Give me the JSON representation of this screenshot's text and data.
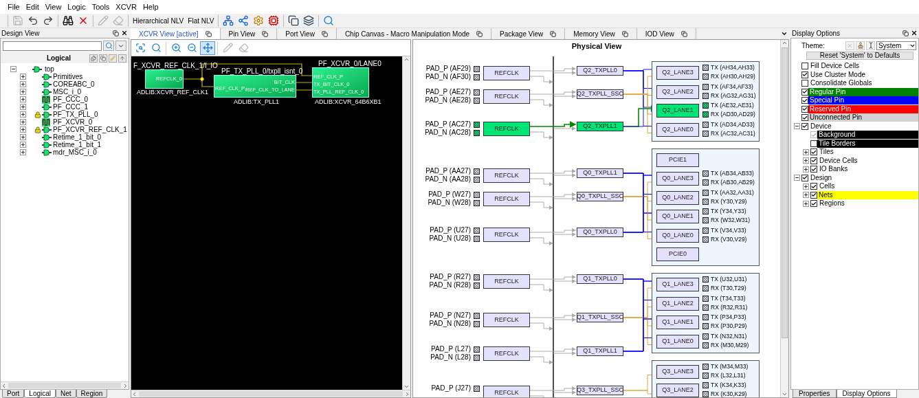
{
  "menu": [
    "File",
    "Edit",
    "View",
    "Logic",
    "Tools",
    "XCVR",
    "Help"
  ],
  "toolbar": [
    {
      "buttons": [
        {
          "kind": "save",
          "disabled": true
        },
        {
          "kind": "undo",
          "disabled": false
        },
        {
          "kind": "redo",
          "disabled": false
        }
      ]
    },
    {
      "buttons": [
        {
          "kind": "find",
          "disabled": false
        },
        {
          "kind": "delete",
          "disabled": false
        }
      ]
    },
    {
      "buttons": [
        {
          "kind": "edit",
          "disabled": true
        },
        {
          "kind": "erase",
          "disabled": true
        }
      ]
    },
    {
      "buttons": [
        {
          "kind": "text",
          "label": "Hierarchical NLV",
          "disabled": false
        },
        {
          "kind": "text",
          "label": "Flat NLV",
          "disabled": false
        }
      ]
    },
    {
      "buttons": [
        {
          "kind": "netin",
          "disabled": false
        },
        {
          "kind": "netout",
          "disabled": false
        },
        {
          "kind": "gear",
          "disabled": false
        },
        {
          "kind": "chip",
          "disabled": false
        }
      ]
    },
    {
      "buttons": [
        {
          "kind": "window",
          "disabled": false
        },
        {
          "kind": "windows",
          "disabled": false
        }
      ]
    },
    {
      "buttons": [
        {
          "kind": "zoom",
          "disabled": false
        }
      ]
    }
  ],
  "design_view": {
    "title": "Design View",
    "header": "Logical",
    "tree": {
      "label": "top",
      "kind": "gate",
      "locked": false,
      "expanded": true,
      "children": [
        {
          "label": "Primitives",
          "kind": "gate",
          "locked": false,
          "expanded": false
        },
        {
          "label": "COREABC_0",
          "kind": "gate",
          "locked": false,
          "expanded": false
        },
        {
          "label": "MSC_i_0",
          "kind": "gate",
          "locked": false,
          "expanded": false
        },
        {
          "label": "PF_CCC_0",
          "kind": "pulse",
          "locked": false,
          "expanded": false
        },
        {
          "label": "PF_CCC_1",
          "kind": "gate",
          "locked": false,
          "expanded": false
        },
        {
          "label": "PF_TX_PLL_0",
          "kind": "gate",
          "locked": true,
          "expanded": false
        },
        {
          "label": "PF_XCVR_0",
          "kind": "pulse",
          "locked": false,
          "expanded": false
        },
        {
          "label": "PF_XCVR_REF_CLK_1",
          "kind": "gate",
          "locked": true,
          "expanded": false
        },
        {
          "label": "Retime_1_bit_0",
          "kind": "gate",
          "locked": false,
          "expanded": false
        },
        {
          "label": "Retime_1_bit_1",
          "kind": "gate",
          "locked": false,
          "expanded": false
        },
        {
          "label": "mdr_MSC_i_0",
          "kind": "gate",
          "locked": false,
          "expanded": false
        }
      ]
    },
    "tabs": [
      {
        "label": "Port",
        "selected": false
      },
      {
        "label": "Logical",
        "selected": true
      },
      {
        "label": "Net",
        "selected": false
      },
      {
        "label": "Region",
        "selected": false
      }
    ]
  },
  "view_tabs": [
    {
      "label": "XCVR View [active]",
      "selected": true
    },
    {
      "label": "Pin View",
      "selected": false
    },
    {
      "label": "Port View",
      "selected": false
    },
    {
      "label": "Chip Canvas - Macro Manipulation Mode",
      "selected": false
    },
    {
      "label": "Package View",
      "selected": false
    },
    {
      "label": "Memory View",
      "selected": false
    },
    {
      "label": "IOD View",
      "selected": false
    }
  ],
  "xcvr_view": {
    "tools": [
      {
        "kind": "zoomwindow",
        "selected": false,
        "disabled": false
      },
      {
        "kind": "zoomcheck",
        "selected": false,
        "disabled": false
      },
      {
        "kind": "zoomin",
        "selected": false,
        "disabled": false
      },
      {
        "kind": "zoomout",
        "selected": false,
        "disabled": false
      },
      {
        "kind": "fit",
        "selected": true,
        "disabled": false
      },
      {
        "kind": "edit",
        "selected": false,
        "disabled": true
      },
      {
        "kind": "erase",
        "selected": false,
        "disabled": true
      }
    ],
    "nodes": [
      {
        "title": "F_XCVR_REF_CLK_1/I_IO",
        "type": "ADLIB:XCVR_REF_CLK1",
        "outputs": [
          "REFCLK_0"
        ]
      },
      {
        "title": "PF_TX_PLL_0/txpll_isnt_0",
        "type": "ADLIB:TX_PLL1",
        "inputs": [
          "REF_CLK_P"
        ],
        "outputs": [
          "BIT_CLK",
          "REF_CLK_TO_LANE"
        ]
      },
      {
        "title": "PF_XCVR_0/LANE0",
        "type": "ADLIB:XCVR_64B6XB1",
        "inputs": [
          "REF_CLK_P",
          "TX_BIT_CLK_0",
          "TX_PLL_REF_CLK_0"
        ]
      }
    ]
  },
  "physical_view": {
    "title": "Physical View",
    "quads": [
      {
        "refclks": [
          {
            "pad_p": "PAD_P (AF29)",
            "pad_n": "PAD_N (AF30)",
            "label": "REFCLK",
            "highlighted": false
          },
          {
            "pad_p": "PAD_P (AE27)",
            "pad_n": "PAD_N (AE28)",
            "label": "REFCLK",
            "highlighted": false
          },
          {
            "pad_p": "PAD_P (AC27)",
            "pad_n": "PAD_N (AC28)",
            "label": "REFCLK",
            "highlighted": true
          }
        ],
        "plls": [
          {
            "label": "Q2_TXPLL0",
            "kind": "pll",
            "highlighted": false
          },
          {
            "label": "Q2_TXPLL_SSC",
            "kind": "ssc",
            "highlighted": false
          },
          {
            "label": "Q2_TXPLL1",
            "kind": "pll",
            "highlighted": true
          }
        ],
        "items": [
          {
            "kind": "lane",
            "label": "Q2_LANE3",
            "highlighted": false,
            "tx": "TX (AH34,AH33)",
            "rx": "RX (AH30,AH29)"
          },
          {
            "kind": "lane",
            "label": "Q2_LANE2",
            "highlighted": false,
            "tx": "TX (AF34,AF33)",
            "rx": "RX (AG32,AG31)"
          },
          {
            "kind": "lane",
            "label": "Q2_LANE1",
            "highlighted": true,
            "tx": "TX (AE32,AE31)",
            "rx": "RX (AD30,AD29)"
          },
          {
            "kind": "lane",
            "label": "Q2_LANE0",
            "highlighted": false,
            "tx": "TX (AD34,AD33)",
            "rx": "RX (AC32,AC31)"
          }
        ]
      },
      {
        "refclks": [
          {
            "pad_p": "PAD_P (AA27)",
            "pad_n": "PAD_N (AA28)",
            "label": "REFCLK",
            "highlighted": false
          },
          {
            "pad_p": "PAD_P (W27)",
            "pad_n": "PAD_N (W28)",
            "label": "REFCLK",
            "highlighted": false
          },
          {
            "pad_p": "PAD_P (U27)",
            "pad_n": "PAD_N (U28)",
            "label": "REFCLK",
            "highlighted": false
          }
        ],
        "plls": [
          {
            "label": "Q0_TXPLL1",
            "kind": "pll",
            "highlighted": false
          },
          {
            "label": "Q0_TXPLL_SSC",
            "kind": "ssc",
            "highlighted": false
          },
          {
            "label": "Q0_TXPLL0",
            "kind": "pll",
            "highlighted": false
          }
        ],
        "items": [
          {
            "kind": "pcie",
            "label": "PCIE1",
            "highlighted": false
          },
          {
            "kind": "lane",
            "label": "Q0_LANE3",
            "highlighted": false,
            "tx": "TX (AB34,AB33)",
            "rx": "RX (AB30,AB29)"
          },
          {
            "kind": "lane",
            "label": "Q0_LANE2",
            "highlighted": false,
            "tx": "TX (AA32,AA31)",
            "rx": "RX (Y30,Y29)"
          },
          {
            "kind": "lane",
            "label": "Q0_LANE1",
            "highlighted": false,
            "tx": "TX (Y34,Y33)",
            "rx": "RX (W32,W31)"
          },
          {
            "kind": "lane",
            "label": "Q0_LANE0",
            "highlighted": false,
            "tx": "TX (V34,V33)",
            "rx": "RX (V30,V29)"
          },
          {
            "kind": "pcie",
            "label": "PCIE0",
            "highlighted": false
          }
        ]
      },
      {
        "refclks": [
          {
            "pad_p": "PAD_P (R27)",
            "pad_n": "PAD_N (R28)",
            "label": "REFCLK",
            "highlighted": false
          },
          {
            "pad_p": "PAD_P (N27)",
            "pad_n": "PAD_N (N28)",
            "label": "REFCLK",
            "highlighted": false
          },
          {
            "pad_p": "PAD_P (L27)",
            "pad_n": "PAD_N (L28)",
            "label": "REFCLK",
            "highlighted": false
          }
        ],
        "plls": [
          {
            "label": "Q1_TXPLL0",
            "kind": "pll",
            "highlighted": false
          },
          {
            "label": "Q1_TXPLL_SSC",
            "kind": "ssc",
            "highlighted": false
          },
          {
            "label": "Q1_TXPLL1",
            "kind": "pll",
            "highlighted": false
          }
        ],
        "items": [
          {
            "kind": "lane",
            "label": "Q1_LANE3",
            "highlighted": false,
            "tx": "TX (U32,U31)",
            "rx": "RX (T30,T29)"
          },
          {
            "kind": "lane",
            "label": "Q1_LANE2",
            "highlighted": false,
            "tx": "TX (T34,T33)",
            "rx": "RX (R32,R31)"
          },
          {
            "kind": "lane",
            "label": "Q1_LANE1",
            "highlighted": false,
            "tx": "TX (P34,P33)",
            "rx": "RX (P30,P29)"
          },
          {
            "kind": "lane",
            "label": "Q1_LANE0",
            "highlighted": false,
            "tx": "TX (N32,N31)",
            "rx": "RX (M30,M29)"
          }
        ]
      },
      {
        "refclks": [
          {
            "pad_p": "PAD_P (J27)",
            "label": "REFCLK",
            "highlighted": false
          }
        ],
        "plls": [
          {
            "label": "Q3_TXPLL_SSC",
            "kind": "ssc",
            "highlighted": false
          }
        ],
        "items": [
          {
            "kind": "lane",
            "label": "Q3_LANE3",
            "highlighted": false,
            "tx": "TX (M34,M33)",
            "rx": "RX (L32,L31)"
          },
          {
            "kind": "lane",
            "label": "Q3_LANE2",
            "highlighted": false,
            "tx": "TX (K34,K33)",
            "rx": "RX (K30,K29)"
          }
        ]
      }
    ]
  },
  "display_options": {
    "title": "Display Options",
    "theme_label": "Theme:",
    "theme": "System",
    "reset": "Reset 'System' to Defaults",
    "items": [
      {
        "kind": "option",
        "label": "Fill Device Cells",
        "checked": false
      },
      {
        "kind": "option",
        "label": "Use Cluster Mode",
        "checked": true
      },
      {
        "kind": "option",
        "label": "Consolidate Globals",
        "checked": false
      },
      {
        "kind": "option",
        "label": "Regular Pin",
        "checked": true,
        "color": "#008000"
      },
      {
        "kind": "option",
        "label": "Special Pin",
        "checked": true,
        "color": "#0000ff"
      },
      {
        "kind": "option",
        "label": "Reserved Pin",
        "checked": true,
        "color": "#ff0000"
      },
      {
        "kind": "option",
        "label": "Unconnected Pin",
        "checked": true,
        "color": "#d3d3d3"
      },
      {
        "kind": "group",
        "label": "Device",
        "checked": true,
        "expanded": true,
        "children": [
          {
            "kind": "option",
            "label": "Background",
            "checked": true,
            "disabled": true,
            "color": "#000000"
          },
          {
            "kind": "option",
            "label": "Tile Borders",
            "checked": false,
            "disabled": false,
            "color": "#000000"
          },
          {
            "kind": "group",
            "label": "Tiles",
            "checked": true,
            "disabled": false,
            "expanded": false
          },
          {
            "kind": "group",
            "label": "Device Cells",
            "checked": true,
            "disabled": false,
            "expanded": false
          },
          {
            "kind": "group",
            "label": "IO Banks",
            "checked": true,
            "disabled": false,
            "expanded": false
          }
        ]
      },
      {
        "kind": "group",
        "label": "Design",
        "checked": true,
        "expanded": true,
        "children": [
          {
            "kind": "group",
            "label": "Cells",
            "checked": true,
            "expanded": false
          },
          {
            "kind": "group",
            "label": "Nets",
            "checked": true,
            "expanded": false,
            "color": "#ffff00"
          },
          {
            "kind": "group",
            "label": "Regions",
            "checked": true,
            "expanded": false
          }
        ]
      }
    ],
    "tabs": [
      {
        "label": "Properties",
        "selected": false
      },
      {
        "label": "Display Options",
        "selected": true
      }
    ]
  }
}
